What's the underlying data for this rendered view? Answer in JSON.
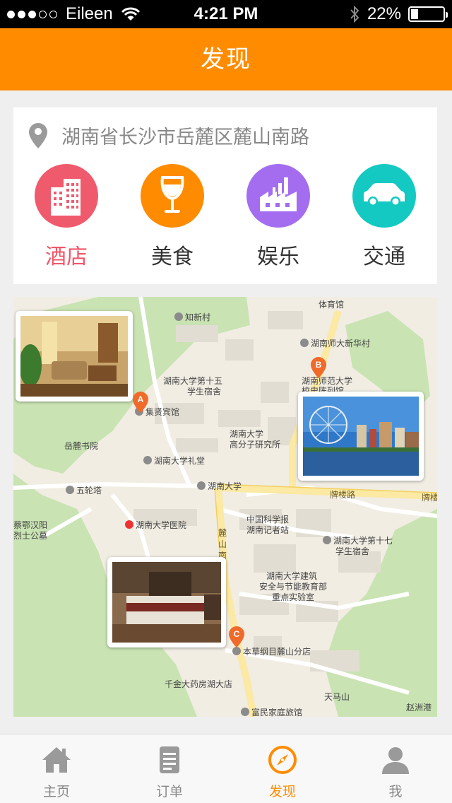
{
  "status_bar": {
    "carrier": "Eileen",
    "time": "4:21 PM",
    "battery": "22%",
    "battery_level": 0.22
  },
  "nav": {
    "title": "发现"
  },
  "location": {
    "address": "湖南省长沙市岳麓区麓山南路"
  },
  "categories": [
    {
      "label": "酒店",
      "icon": "hotel-building-icon",
      "color": "#f05a6d"
    },
    {
      "label": "美食",
      "icon": "wine-glass-icon",
      "color": "#ff8c00"
    },
    {
      "label": "娱乐",
      "icon": "factory-icon",
      "color": "#a46df0"
    },
    {
      "label": "交通",
      "icon": "car-icon",
      "color": "#13c9c1"
    }
  ],
  "map": {
    "labels": {
      "tiyuguan": "体育馆",
      "zhixincun": "知新村",
      "shidaxinhuacun": "湖南师大新华村",
      "hunan_univ_15": "湖南大学第十五",
      "student_dorm_1": "学生宿舍",
      "shifan": "湖南师范大学",
      "chenlidong": "校史陈列馆",
      "jixian": "集贤宾馆",
      "yuelu_academy": "岳麓书院",
      "gaofenzi_1": "湖南大学",
      "gaofenzi_2": "高分子研究所",
      "litang": "湖南大学礼堂",
      "wulunta": "五轮塔",
      "hunan_univ": "湖南大学",
      "pailoulu": "牌楼路",
      "pailou_right": "牌楼",
      "eh_1": "蔡鄂汉阳",
      "eh_2": "烈士公墓",
      "hospital": "湖南大学医院",
      "kexuebao_1": "中国科学报",
      "kexuebao_2": "湖南记者站",
      "lushan_road_1": "麓",
      "lushan_road_2": "山",
      "lushan_road_3": "南",
      "hunan_univ_17": "湖南大学第十七",
      "student_dorm_2": "学生宿舍",
      "lab_1": "湖南大学建筑",
      "lab_2": "安全与节能教育部",
      "lab_3": "重点实验室",
      "bencao": "本草纲目麓山分店",
      "qianjin": "千金大药房湖大店",
      "tianmashan": "天马山",
      "zhouzhougang": "赵洲港",
      "fumin": "富民家庭旅馆"
    },
    "markers": [
      "A",
      "B",
      "C"
    ]
  },
  "tabs": [
    {
      "label": "主页",
      "icon": "home-icon"
    },
    {
      "label": "订单",
      "icon": "order-list-icon"
    },
    {
      "label": "发现",
      "icon": "compass-icon",
      "active": true
    },
    {
      "label": "我",
      "icon": "user-icon"
    }
  ]
}
